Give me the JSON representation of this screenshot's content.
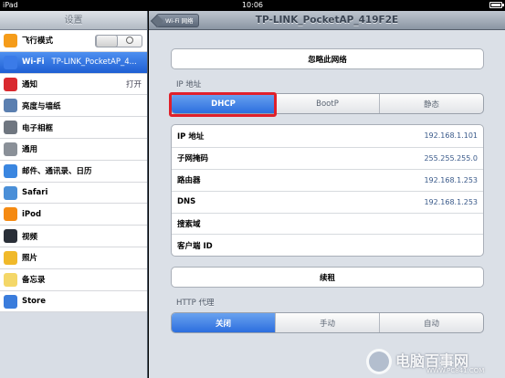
{
  "status_bar": {
    "device": "iPad",
    "time": "10:06"
  },
  "sidebar": {
    "title": "设置",
    "items": [
      {
        "label": "飞行模式",
        "value": "",
        "icon": "airplane-icon",
        "color": "#f59c1a"
      },
      {
        "label": "Wi-Fi",
        "value": "TP-LINK_PocketAP_4...",
        "icon": "wifi-icon",
        "color": "#3b7be8"
      },
      {
        "label": "通知",
        "value": "打开",
        "icon": "notifications-icon",
        "color": "#d9292f"
      },
      {
        "label": "亮度与墙纸",
        "value": "",
        "icon": "brightness-icon",
        "color": "#5b7fb0"
      },
      {
        "label": "电子相框",
        "value": "",
        "icon": "picture-frame-icon",
        "color": "#6f7680"
      },
      {
        "label": "通用",
        "value": "",
        "icon": "gear-icon",
        "color": "#8a9098"
      },
      {
        "label": "邮件、通讯录、日历",
        "value": "",
        "icon": "mail-icon",
        "color": "#3a86e0"
      },
      {
        "label": "Safari",
        "value": "",
        "icon": "safari-icon",
        "color": "#4a8fd8"
      },
      {
        "label": "iPod",
        "value": "",
        "icon": "ipod-icon",
        "color": "#f58a12"
      },
      {
        "label": "视频",
        "value": "",
        "icon": "video-icon",
        "color": "#2a2f38"
      },
      {
        "label": "照片",
        "value": "",
        "icon": "photos-icon",
        "color": "#f0b92a"
      },
      {
        "label": "备忘录",
        "value": "",
        "icon": "notes-icon",
        "color": "#f4d768"
      },
      {
        "label": "Store",
        "value": "",
        "icon": "store-icon",
        "color": "#3a7cdc"
      }
    ]
  },
  "nav": {
    "back_label": "Wi-Fi 网络",
    "title": "TP-LINK_PocketAP_419F2E"
  },
  "forget_button": "忽略此网络",
  "ip_section": {
    "label": "IP 地址",
    "segments": [
      "DHCP",
      "BootP",
      "静态"
    ],
    "selected": "DHCP"
  },
  "ip_table": [
    {
      "key": "IP 地址",
      "value": "192.168.1.101"
    },
    {
      "key": "子网掩码",
      "value": "255.255.255.0"
    },
    {
      "key": "路由器",
      "value": "192.168.1.253"
    },
    {
      "key": "DNS",
      "value": "192.168.1.253"
    },
    {
      "key": "搜索域",
      "value": ""
    },
    {
      "key": "客户端 ID",
      "value": ""
    }
  ],
  "renew_button": "续租",
  "proxy_section": {
    "label": "HTTP 代理",
    "segments": [
      "关闭",
      "手动",
      "自动"
    ],
    "selected": "关闭"
  },
  "watermark": {
    "text": "电脑百事网",
    "url": "WWW.PC841.COM"
  }
}
